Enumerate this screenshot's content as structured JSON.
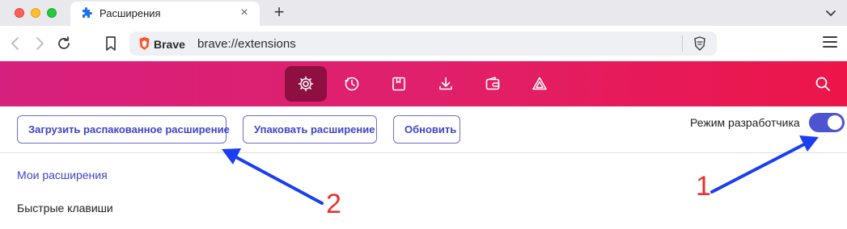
{
  "window": {
    "tab_title": "Расширения",
    "new_tab_symbol": "+",
    "tab_close_symbol": "×"
  },
  "toolbar": {
    "omnibox_brand": "Brave",
    "omnibox_url": "brave://extensions"
  },
  "header": {
    "nav_icons": [
      "gear-icon",
      "history-icon",
      "bookmarks-icon",
      "downloads-icon",
      "wallet-icon",
      "rewards-icon"
    ],
    "active_icon": "gear-icon",
    "gradient_colors": [
      "#d6207d",
      "#ec1549"
    ]
  },
  "actions": {
    "load_unpacked": "Загрузить распакованное расширение",
    "pack": "Упаковать расширение",
    "update": "Обновить",
    "developer_mode_label": "Режим разработчика",
    "developer_mode_on": true
  },
  "sidebar": {
    "my_extensions": "Мои расширения",
    "shortcuts": "Быстрые клавиши"
  },
  "annotations": {
    "label_1": "1",
    "label_2": "2",
    "arrow_color": "#1a3ef0",
    "number_color": "#e8322e"
  },
  "colors": {
    "accent": "#3f44c6",
    "toggle": "#4c54d2"
  }
}
